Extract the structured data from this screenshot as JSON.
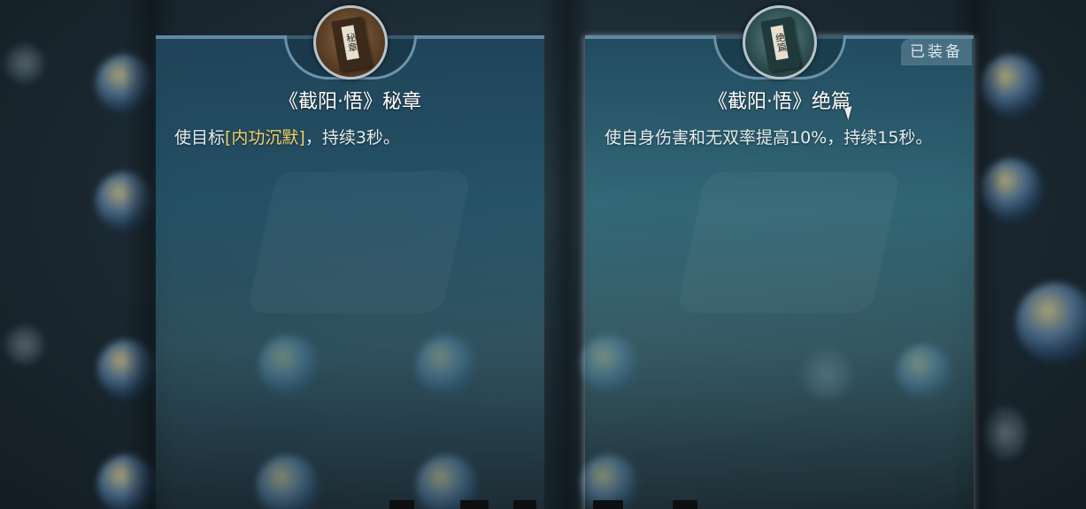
{
  "left_card": {
    "title": "《截阳·悟》秘章",
    "desc_before": "使目标",
    "desc_highlight": "[内功沉默]",
    "desc_after": "，持续3秒。",
    "icon_tag": "秘章"
  },
  "right_card": {
    "title": "《截阳·悟》绝篇",
    "desc": "使自身伤害和无双率提高10%，持续15秒。",
    "badge": "已装备",
    "icon_tag": "绝篇"
  },
  "colors": {
    "highlight": "#f1d36b",
    "card_top_border": "#5f8aa3"
  }
}
